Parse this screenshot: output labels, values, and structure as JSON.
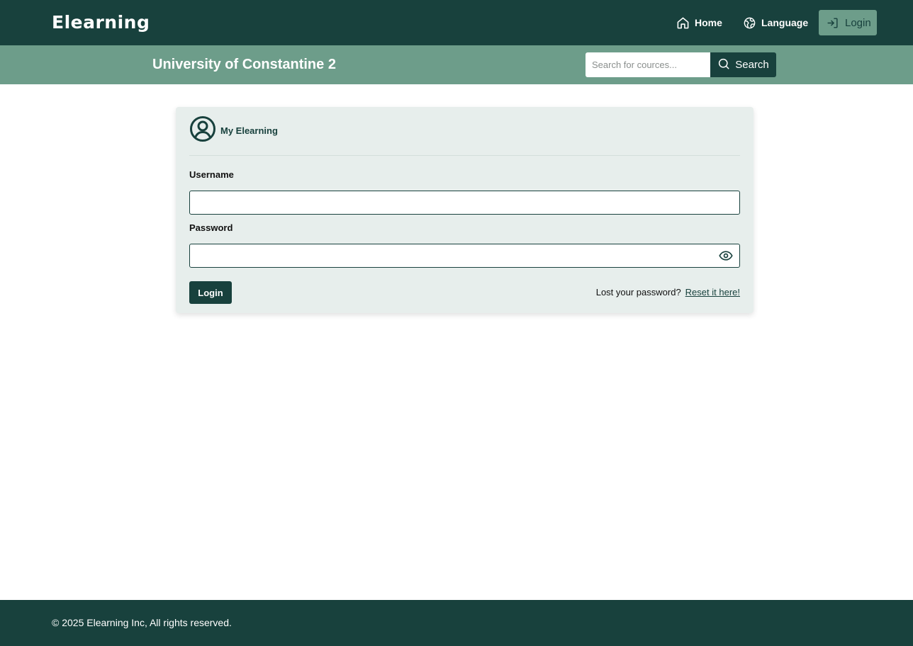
{
  "navbar": {
    "brand": "Elearning",
    "home_label": "Home",
    "language_label": "Language",
    "login_label": "Login"
  },
  "subheader": {
    "title": "University of Constantine 2",
    "search_placeholder": "Search for cources...",
    "search_button": "Search"
  },
  "login_card": {
    "title": "My Elearning",
    "username_label": "Username",
    "username_value": "",
    "password_label": "Password",
    "password_value": "",
    "login_button": "Login",
    "lost_password_text": "Lost your password?",
    "reset_link": "Reset it here!"
  },
  "footer": {
    "copyright": "© 2025 Elearning Inc, All rights reserved."
  },
  "colors": {
    "primary_dark": "#18413d",
    "accent_green": "#6d9d8a",
    "card_bg": "#e7eeec"
  },
  "icons": {
    "home": "home-icon",
    "language": "globe-icon",
    "login": "login-arrow-icon",
    "search": "search-icon",
    "user": "user-circle-icon",
    "password_toggle": "eye-icon"
  }
}
